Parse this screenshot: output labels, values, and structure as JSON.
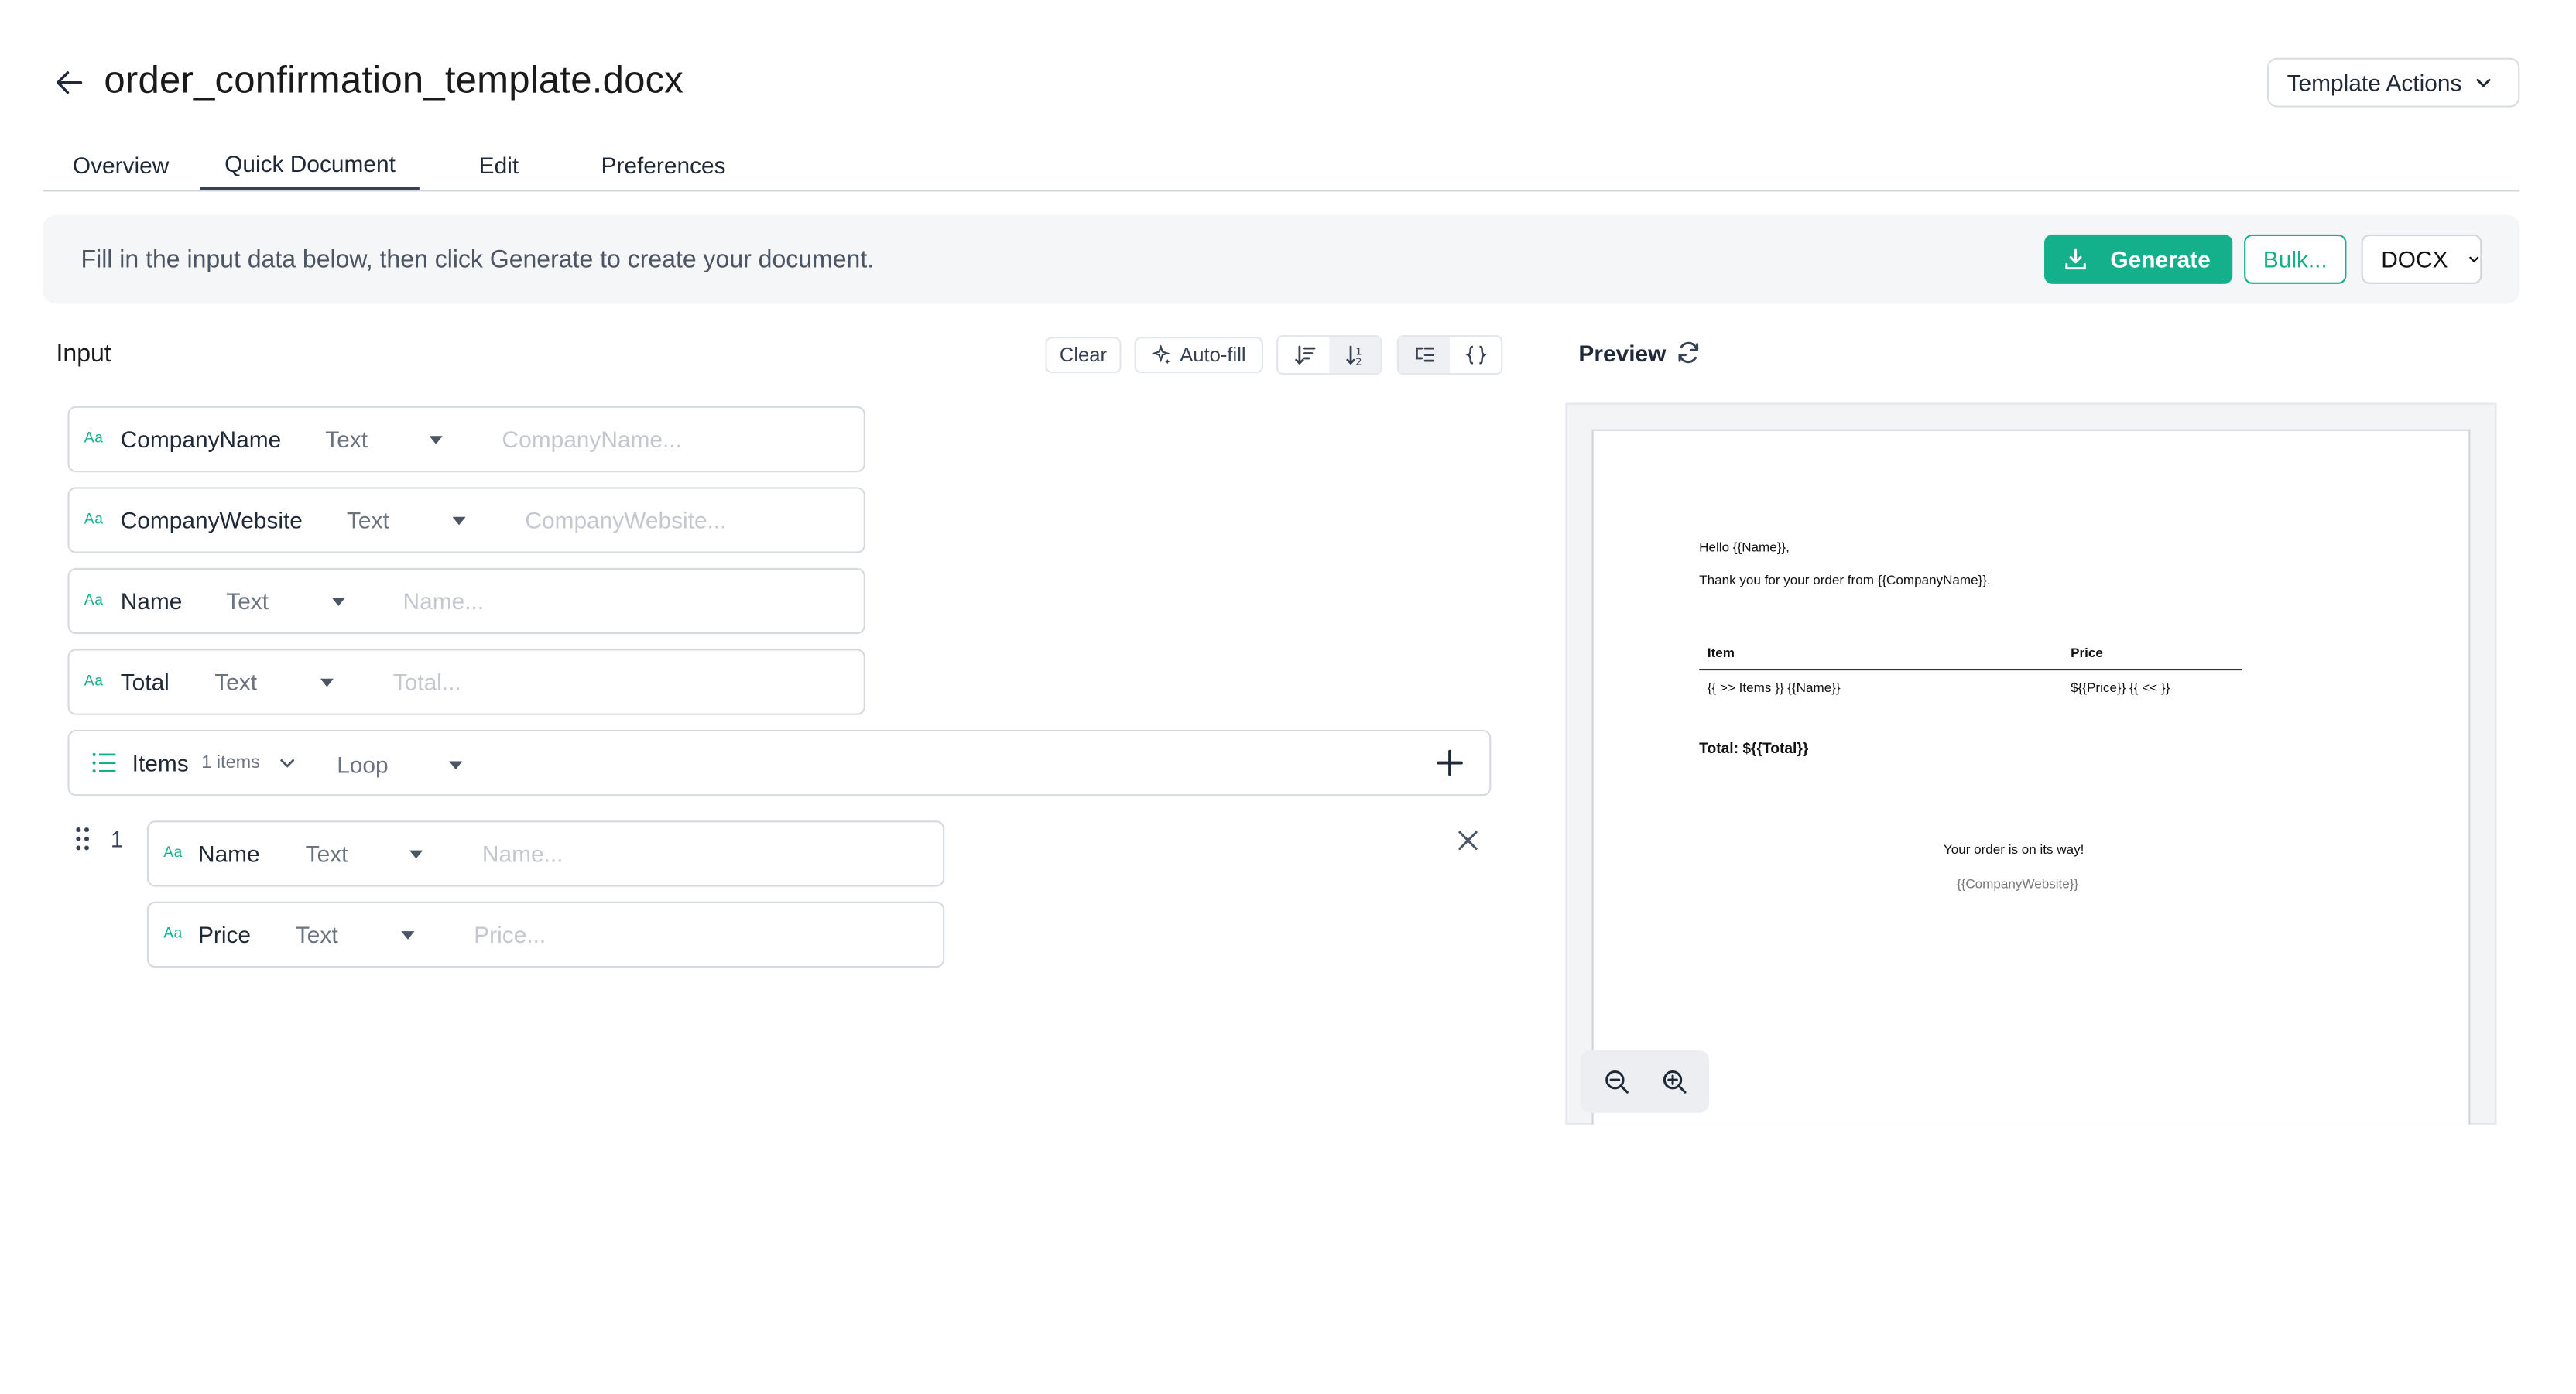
{
  "header": {
    "title": "order_confirmation_template.docx",
    "actions_label": "Template Actions"
  },
  "tabs": [
    {
      "label": "Overview"
    },
    {
      "label": "Quick Document",
      "active": true
    },
    {
      "label": "Edit"
    },
    {
      "label": "Preferences"
    }
  ],
  "infobar": {
    "message": "Fill in the input data below, then click Generate to create your document.",
    "generate_label": "Generate",
    "bulk_label": "Bulk...",
    "format": "DOCX"
  },
  "input": {
    "title": "Input",
    "clear_label": "Clear",
    "autofill_label": "Auto-fill",
    "type_icon_text": "Aa",
    "fields": [
      {
        "name": "CompanyName",
        "type": "Text",
        "placeholder": "CompanyName..."
      },
      {
        "name": "CompanyWebsite",
        "type": "Text",
        "placeholder": "CompanyWebsite..."
      },
      {
        "name": "Name",
        "type": "Text",
        "placeholder": "Name..."
      },
      {
        "name": "Total",
        "type": "Text",
        "placeholder": "Total..."
      }
    ],
    "loop": {
      "name": "Items",
      "count": "1 items",
      "type": "Loop",
      "rows": [
        {
          "index": "1",
          "fields": [
            {
              "name": "Name",
              "type": "Text",
              "placeholder": "Name..."
            },
            {
              "name": "Price",
              "type": "Text",
              "placeholder": "Price..."
            }
          ]
        }
      ]
    }
  },
  "preview": {
    "title": "Preview",
    "doc": {
      "greeting": "Hello {{Name}},",
      "thanks": "Thank you for your order from {{CompanyName}}.",
      "col_item": "Item",
      "col_price": "Price",
      "row_item": "{{ >> Items }} {{Name}}",
      "row_price": "${{Price}} {{ << }}",
      "total": "Total: ${{Total}}",
      "footer": "Your order is on its way!",
      "website": "{{CompanyWebsite}}"
    }
  },
  "colors": {
    "accent": "#14b08c",
    "border": "#d6d9de",
    "placeholder": "#c4c8ce"
  }
}
